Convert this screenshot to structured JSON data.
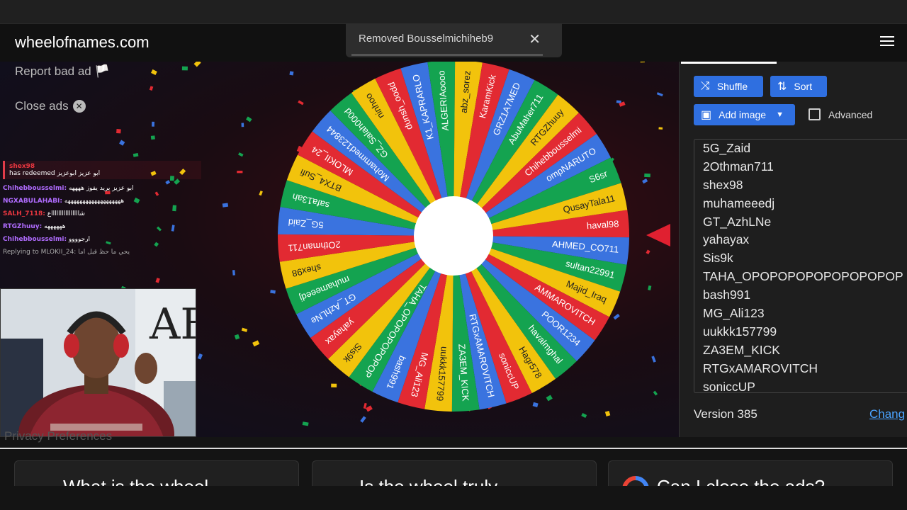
{
  "brand": "wheelofnames.com",
  "toast": {
    "message": "Removed Bousselmichiheb9",
    "close": "✕"
  },
  "ads": {
    "report": "Report bad ad 🏳️",
    "close": "Close ads"
  },
  "chat": {
    "redeem_user": "shex98",
    "redeem_text": "has redeemed ابو عزيز ابوعزيز",
    "messages": [
      {
        "user": "Chihebbousselmi:",
        "color": "#b06cff",
        "text": "ابو عزيز يريد يفوز ههههه"
      },
      {
        "user": "NGXABULAHABI:",
        "color": "#b06cff",
        "text": "هههههههههههههههههههه"
      },
      {
        "user": "SALH_7118:",
        "color": "#e8363f",
        "text": "شااااااااااااااااع"
      },
      {
        "user": "RTGZhuuy:",
        "color": "#b06cff",
        "text": "ههههههه"
      },
      {
        "user": "Chihebbousselmi:",
        "color": "#b06cff",
        "text": "ارجوووو"
      }
    ],
    "reply": "Replying to MLOKII_24: يحي ما حظ قبل اما"
  },
  "wheel": {
    "segments": [
      "haval98",
      "AHMED_CO711",
      "sultan22991",
      "Majid_Iraq",
      "AMMAROVITCH",
      "POOR1234",
      "havalmghal",
      "Hagr578",
      "soniccUP",
      "RTGxAMAROVITCH",
      "ZA3EM_KICK",
      "uukkk157799",
      "MG_Ali123",
      "bash991",
      "TAHA_OPOPOPOPOPOP",
      "Sis9k",
      "yahayax",
      "GT_AzhLNe",
      "muhameeedj",
      "shex98",
      "2Othman711",
      "5G_Zaid",
      "safa13ah",
      "BTX4_Sufi",
      "MLOKII_24",
      "Mohammed123844",
      "GZ_Salah000d",
      "ninhoo",
      "dunsh_oodd",
      "K1_KAPRARLO",
      "ALGERIAoooo",
      "abz_sorez",
      "KaramKick",
      "GRZ1A7MED",
      "AbuMaher711",
      "RTGZhuuy",
      "Chihebbousselmi",
      "ompNARUTO",
      "S6sr",
      "QusayTala11"
    ],
    "colors": [
      "#e22a32",
      "#3a73df",
      "#14a350",
      "#f2c30c"
    ]
  },
  "panel": {
    "shuffle": "Shuffle",
    "sort": "Sort",
    "add_image": "Add image",
    "advanced": "Advanced",
    "entries": [
      "5G_Zaid",
      "2Othman711",
      "shex98",
      "muhameeedj",
      "GT_AzhLNe",
      "yahayax",
      "Sis9k",
      "TAHA_OPOPOPOPOPOPOPOPOP",
      "bash991",
      "MG_Ali123",
      "uukkk157799",
      "ZA3EM_KICK",
      "RTGxAMAROVITCH",
      "soniccUP"
    ],
    "version": "Version 385",
    "changelog": "Chang"
  },
  "privacy": "Privacy Preferences",
  "faq": [
    "What is the wheel",
    "Is the wheel truly",
    "Can I close the ads?"
  ],
  "webcam_text": "AB"
}
